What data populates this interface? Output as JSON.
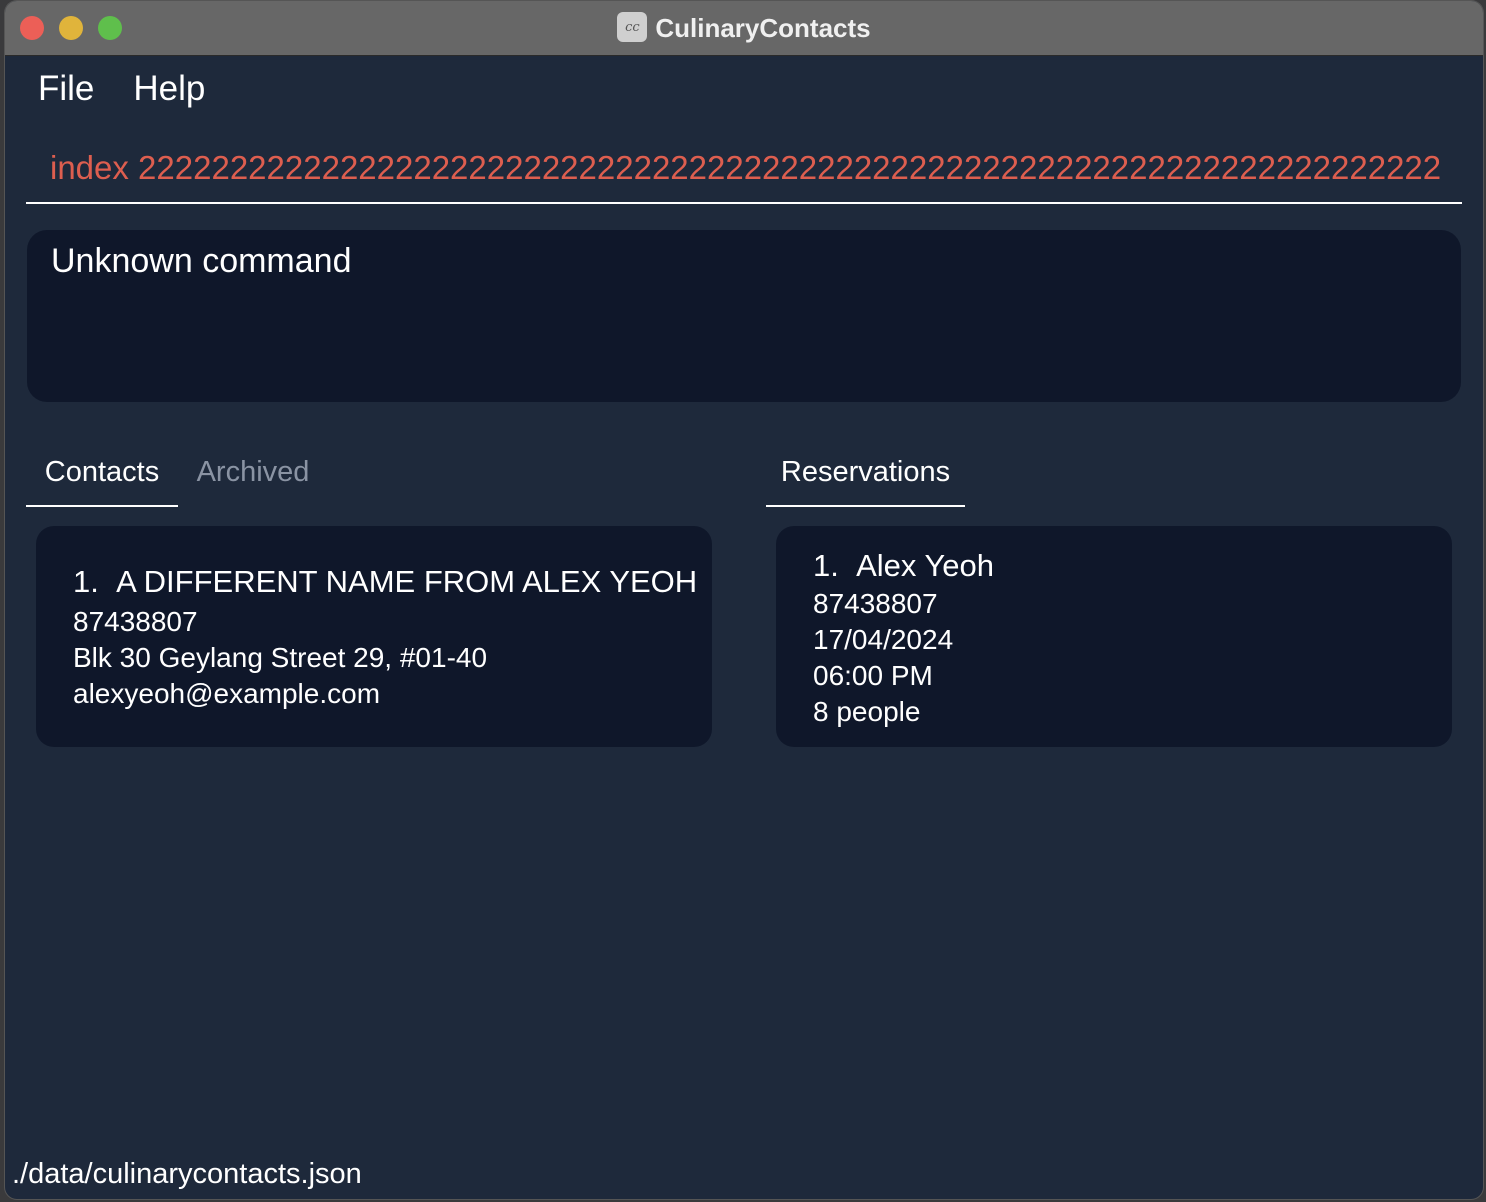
{
  "window": {
    "title": "CulinaryContacts",
    "app_icon_text": "cc"
  },
  "menu": {
    "items": [
      "File",
      "Help"
    ]
  },
  "command": {
    "value": "index 22222222222222222222222222222222222222222222222222222222222222222222222222222222222222222222222222",
    "text_color": "#dd5e4f"
  },
  "result": {
    "message": "Unknown command"
  },
  "tabs": {
    "contacts": "Contacts",
    "archived": "Archived",
    "reservations": "Reservations",
    "active": [
      "Contacts",
      "Reservations"
    ]
  },
  "contacts": [
    {
      "index": "1.",
      "name": "A DIFFERENT NAME FROM ALEX YEOH",
      "phone": "87438807",
      "address": "Blk 30 Geylang Street 29, #01-40",
      "email": "alexyeoh@example.com"
    }
  ],
  "reservations": [
    {
      "index": "1.",
      "name": "Alex Yeoh",
      "phone": "87438807",
      "date": "17/04/2024",
      "time": "06:00 PM",
      "pax": "8 people"
    }
  ],
  "status": {
    "file_path": "./data/culinarycontacts.json"
  },
  "colors": {
    "background": "#1e293b",
    "panel": "#0f172a",
    "titlebar": "#676767",
    "inactive_tab": "#8a93a3"
  },
  "icons": [
    "close-traffic-light",
    "minimize-traffic-light",
    "maximize-traffic-light",
    "app-icon"
  ]
}
